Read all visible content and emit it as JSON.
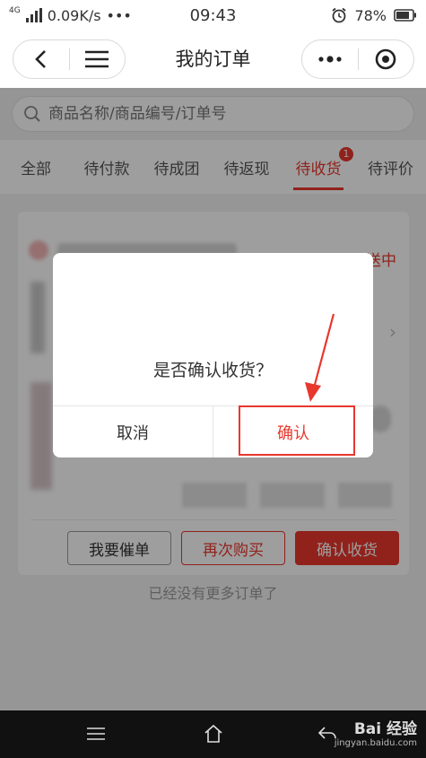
{
  "status_bar": {
    "network": "0.09K/s",
    "network_type": "4G",
    "dots": "•••",
    "time": "09:43",
    "battery": "78%"
  },
  "navbar": {
    "title": "我的订单"
  },
  "search": {
    "placeholder": "商品名称/商品编号/订单号"
  },
  "tabs": [
    {
      "label": "全部"
    },
    {
      "label": "待付款"
    },
    {
      "label": "待成团"
    },
    {
      "label": "待返现"
    },
    {
      "label": "待收货",
      "badge": "1",
      "active": true
    },
    {
      "label": "待评价"
    }
  ],
  "order": {
    "status": "配送中",
    "actions": {
      "urge": "我要催单",
      "rebuy": "再次购买",
      "confirm": "确认收货"
    }
  },
  "footer": {
    "no_more": "已经没有更多订单了"
  },
  "dialog": {
    "message": "是否确认收货？",
    "cancel": "取消",
    "confirm": "确认"
  },
  "watermark": {
    "main": "Bai 经验",
    "sub": "jingyan.baidu.com"
  },
  "colors": {
    "accent": "#e8372d"
  }
}
